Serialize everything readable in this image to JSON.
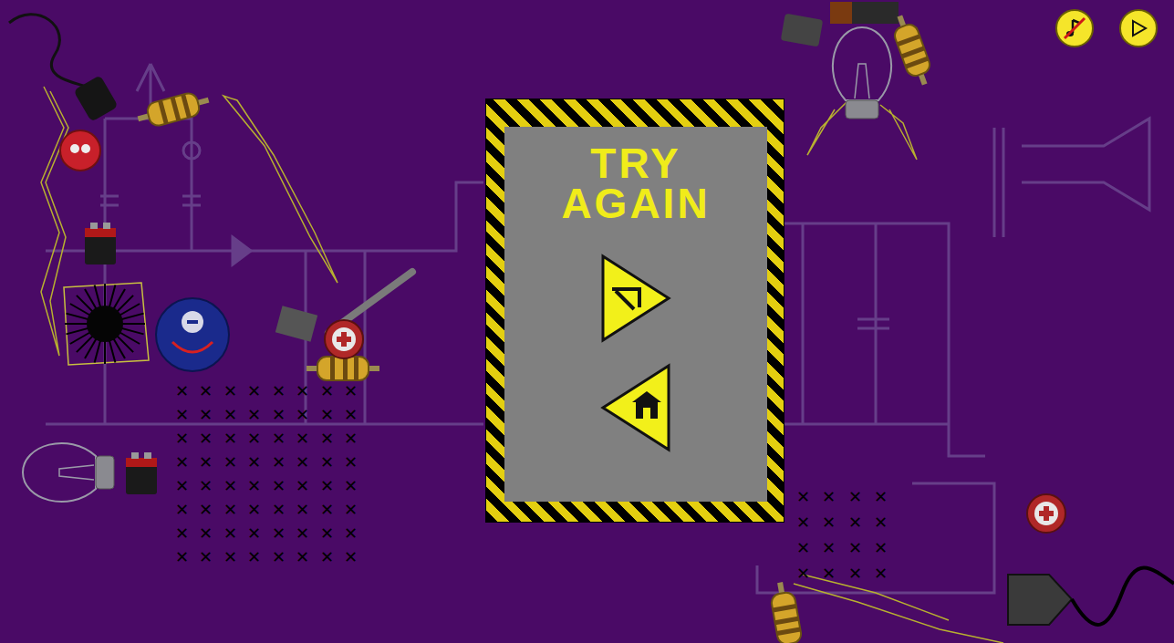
{
  "top_bar": {
    "music": {
      "muted": true
    }
  },
  "dialog": {
    "title_lines": [
      "TRY",
      "AGAIN"
    ]
  },
  "x_grids": [
    {
      "mark": "✕",
      "rows": 8,
      "cols": 8
    },
    {
      "mark": "✕",
      "rows": 4,
      "cols": 4
    }
  ]
}
